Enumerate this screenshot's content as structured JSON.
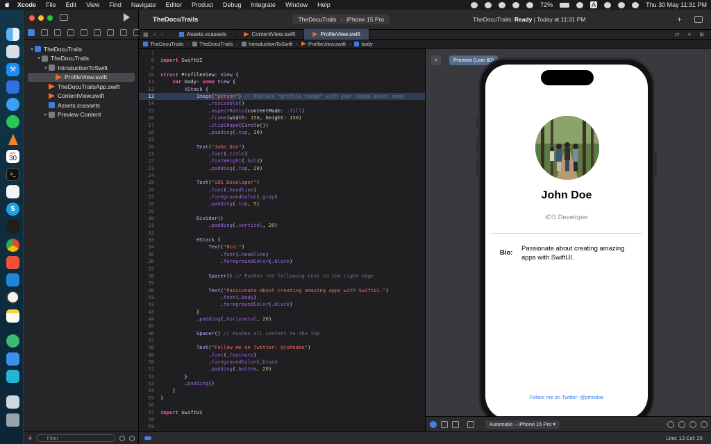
{
  "menubar": {
    "items": [
      "Xcode",
      "File",
      "Edit",
      "View",
      "Find",
      "Navigate",
      "Editor",
      "Product",
      "Debug",
      "Integrate",
      "Window",
      "Help"
    ],
    "battery": "72%",
    "datetime": "Thu 30 May  11:31 PM",
    "input_source": "A"
  },
  "dock": {
    "calendar_day": "30",
    "calendar_month": "MAY",
    "apps": [
      "finder-icon",
      "launchpad-icon",
      "xcode-icon",
      "simulator-icon",
      "safari-icon",
      "whatsapp-icon",
      "vlc-icon",
      "calendar-icon",
      "terminal-icon",
      "reminders-icon",
      "skype-icon",
      "figma-icon",
      "chrome-icon",
      "swift-playgrounds-icon",
      "vscode-icon",
      "clock-icon",
      "notes-icon",
      "time-machine-icon",
      "mail-icon",
      "canva-icon",
      "screenshot-icon",
      "trash-icon"
    ]
  },
  "navigator": {
    "filter_placeholder": "Filter",
    "tree": [
      {
        "label": "TheDocuTrails",
        "indent": 0,
        "kind": "proj",
        "chev": "▾"
      },
      {
        "label": "TheDocuTrails",
        "indent": 1,
        "kind": "folder",
        "chev": "▾"
      },
      {
        "label": "IntroductionToSwift",
        "indent": 2,
        "kind": "folder",
        "chev": "▾"
      },
      {
        "label": "ProfileView.swift",
        "indent": 3,
        "kind": "swift",
        "chev": "",
        "selected": true
      },
      {
        "label": "TheDocuTrailsApp.swift",
        "indent": 2,
        "kind": "swift",
        "chev": ""
      },
      {
        "label": "ContentView.swift",
        "indent": 2,
        "kind": "swift",
        "chev": ""
      },
      {
        "label": "Assets.xcassets",
        "indent": 2,
        "kind": "assets",
        "chev": ""
      },
      {
        "label": "Preview Content",
        "indent": 2,
        "kind": "folder",
        "chev": "▸"
      }
    ]
  },
  "toolbar": {
    "title": "TheDocuTrails",
    "scheme_target": "TheDocuTrails",
    "scheme_device": "iPhone 15 Pro",
    "status_project": "TheDocuTrails:",
    "status_state": "Ready",
    "status_time": "| Today at 11:31 PM"
  },
  "tabs": [
    {
      "label": "Assets.xcassets",
      "active": false
    },
    {
      "label": "ContentView.swift",
      "active": false
    },
    {
      "label": "ProfileView.swift",
      "active": true
    }
  ],
  "jumpbar": [
    "TheDocuTrails",
    "TheDocuTrails",
    "IntroductionToSwift",
    "ProfileView.swift",
    "body"
  ],
  "code": [
    {
      "n": "7",
      "h": []
    },
    {
      "n": "8",
      "h": [
        [
          "kw",
          "import"
        ],
        [
          "pl",
          " SwiftUI"
        ]
      ]
    },
    {
      "n": "9",
      "h": []
    },
    {
      "n": "10",
      "h": [
        [
          "kw",
          "struct"
        ],
        [
          "pl",
          " ProfileView: "
        ],
        [
          "ty",
          "View"
        ],
        [
          "pl",
          " {"
        ]
      ]
    },
    {
      "n": "11",
      "h": [
        [
          "pl",
          "    "
        ],
        [
          "kw",
          "var"
        ],
        [
          "pl",
          " body: "
        ],
        [
          "kw",
          "some"
        ],
        [
          "pl",
          " "
        ],
        [
          "ty",
          "View"
        ],
        [
          "pl",
          " {"
        ]
      ]
    },
    {
      "n": "12",
      "h": [
        [
          "pl",
          "        "
        ],
        [
          "ty",
          "VStack"
        ],
        [
          "pl",
          " {"
        ]
      ]
    },
    {
      "n": "13",
      "cur": true,
      "h": [
        [
          "pl",
          "            "
        ],
        [
          "ty",
          "Image"
        ],
        [
          "pl",
          "("
        ],
        [
          "str",
          "\"person\""
        ],
        [
          "pl",
          ") "
        ],
        [
          "cmt",
          "// Replace \"profile_image\" with your image asset name"
        ]
      ]
    },
    {
      "n": "14",
      "h": [
        [
          "pl",
          "                ."
        ],
        [
          "mem",
          "resizable"
        ],
        [
          "pl",
          "()"
        ]
      ]
    },
    {
      "n": "15",
      "h": [
        [
          "pl",
          "                ."
        ],
        [
          "mem",
          "aspectRatio"
        ],
        [
          "pl",
          "(contentMode: ."
        ],
        [
          "mem",
          "fill"
        ],
        [
          "pl",
          ")"
        ]
      ]
    },
    {
      "n": "16",
      "h": [
        [
          "pl",
          "                ."
        ],
        [
          "mem",
          "frame"
        ],
        [
          "pl",
          "(width: "
        ],
        [
          "num",
          "150"
        ],
        [
          "pl",
          ", height: "
        ],
        [
          "num",
          "150"
        ],
        [
          "pl",
          ")"
        ]
      ]
    },
    {
      "n": "17",
      "h": [
        [
          "pl",
          "                ."
        ],
        [
          "mem",
          "clipShape"
        ],
        [
          "pl",
          "("
        ],
        [
          "ty",
          "Circle"
        ],
        [
          "pl",
          "())"
        ]
      ]
    },
    {
      "n": "18",
      "h": [
        [
          "pl",
          "                ."
        ],
        [
          "mem",
          "padding"
        ],
        [
          "pl",
          "(."
        ],
        [
          "mem",
          "top"
        ],
        [
          "pl",
          ", "
        ],
        [
          "num",
          "30"
        ],
        [
          "pl",
          ")"
        ]
      ]
    },
    {
      "n": "19",
      "h": []
    },
    {
      "n": "20",
      "h": [
        [
          "pl",
          "            "
        ],
        [
          "ty",
          "Text"
        ],
        [
          "pl",
          "("
        ],
        [
          "str",
          "\"John Doe\""
        ],
        [
          "pl",
          ")"
        ]
      ]
    },
    {
      "n": "21",
      "h": [
        [
          "pl",
          "                ."
        ],
        [
          "mem",
          "font"
        ],
        [
          "pl",
          "(."
        ],
        [
          "mem",
          "title"
        ],
        [
          "pl",
          ")"
        ]
      ]
    },
    {
      "n": "22",
      "h": [
        [
          "pl",
          "                ."
        ],
        [
          "mem",
          "fontWeight"
        ],
        [
          "pl",
          "(."
        ],
        [
          "mem",
          "bold"
        ],
        [
          "pl",
          ")"
        ]
      ]
    },
    {
      "n": "23",
      "h": [
        [
          "pl",
          "                ."
        ],
        [
          "mem",
          "padding"
        ],
        [
          "pl",
          "(."
        ],
        [
          "mem",
          "top"
        ],
        [
          "pl",
          ", "
        ],
        [
          "num",
          "20"
        ],
        [
          "pl",
          ")"
        ]
      ]
    },
    {
      "n": "24",
      "h": []
    },
    {
      "n": "25",
      "h": [
        [
          "pl",
          "            "
        ],
        [
          "ty",
          "Text"
        ],
        [
          "pl",
          "("
        ],
        [
          "str",
          "\"iOS Developer\""
        ],
        [
          "pl",
          ")"
        ]
      ]
    },
    {
      "n": "26",
      "h": [
        [
          "pl",
          "                ."
        ],
        [
          "mem",
          "font"
        ],
        [
          "pl",
          "(."
        ],
        [
          "mem",
          "headline"
        ],
        [
          "pl",
          ")"
        ]
      ]
    },
    {
      "n": "27",
      "h": [
        [
          "pl",
          "                ."
        ],
        [
          "mem",
          "foregroundColor"
        ],
        [
          "pl",
          "(."
        ],
        [
          "mem",
          "gray"
        ],
        [
          "pl",
          ")"
        ]
      ]
    },
    {
      "n": "28",
      "h": [
        [
          "pl",
          "                ."
        ],
        [
          "mem",
          "padding"
        ],
        [
          "pl",
          "(."
        ],
        [
          "mem",
          "top"
        ],
        [
          "pl",
          ", "
        ],
        [
          "num",
          "5"
        ],
        [
          "pl",
          ")"
        ]
      ]
    },
    {
      "n": "29",
      "h": []
    },
    {
      "n": "30",
      "h": [
        [
          "pl",
          "            "
        ],
        [
          "ty",
          "Divider"
        ],
        [
          "pl",
          "()"
        ]
      ]
    },
    {
      "n": "31",
      "h": [
        [
          "pl",
          "                ."
        ],
        [
          "mem",
          "padding"
        ],
        [
          "pl",
          "(."
        ],
        [
          "mem",
          "vertical"
        ],
        [
          "pl",
          ", "
        ],
        [
          "num",
          "20"
        ],
        [
          "pl",
          ")"
        ]
      ]
    },
    {
      "n": "32",
      "h": []
    },
    {
      "n": "33",
      "h": [
        [
          "pl",
          "            "
        ],
        [
          "ty",
          "HStack"
        ],
        [
          "pl",
          " {"
        ]
      ]
    },
    {
      "n": "34",
      "h": [
        [
          "pl",
          "                "
        ],
        [
          "ty",
          "Text"
        ],
        [
          "pl",
          "("
        ],
        [
          "str",
          "\"Bio:\""
        ],
        [
          "pl",
          ")"
        ]
      ]
    },
    {
      "n": "35",
      "h": [
        [
          "pl",
          "                    ."
        ],
        [
          "mem",
          "font"
        ],
        [
          "pl",
          "(."
        ],
        [
          "mem",
          "headline"
        ],
        [
          "pl",
          ")"
        ]
      ]
    },
    {
      "n": "36",
      "h": [
        [
          "pl",
          "                    ."
        ],
        [
          "mem",
          "foregroundColor"
        ],
        [
          "pl",
          "(."
        ],
        [
          "mem",
          "black"
        ],
        [
          "pl",
          ")"
        ]
      ]
    },
    {
      "n": "37",
      "h": []
    },
    {
      "n": "38",
      "h": [
        [
          "pl",
          "                "
        ],
        [
          "ty",
          "Spacer"
        ],
        [
          "pl",
          "() "
        ],
        [
          "cmt",
          "// Pushes the following text to the right edge"
        ]
      ]
    },
    {
      "n": "39",
      "h": []
    },
    {
      "n": "40",
      "h": [
        [
          "pl",
          "                "
        ],
        [
          "ty",
          "Text"
        ],
        [
          "pl",
          "("
        ],
        [
          "str",
          "\"Passionate about creating amazing apps with SwiftUI.\""
        ],
        [
          "pl",
          ")"
        ]
      ]
    },
    {
      "n": "41",
      "h": [
        [
          "pl",
          "                    ."
        ],
        [
          "mem",
          "font"
        ],
        [
          "pl",
          "(."
        ],
        [
          "mem",
          "body"
        ],
        [
          "pl",
          ")"
        ]
      ]
    },
    {
      "n": "42",
      "h": [
        [
          "pl",
          "                    ."
        ],
        [
          "mem",
          "foregroundColor"
        ],
        [
          "pl",
          "(."
        ],
        [
          "mem",
          "black"
        ],
        [
          "pl",
          ")"
        ]
      ]
    },
    {
      "n": "43",
      "h": [
        [
          "pl",
          "            }"
        ]
      ]
    },
    {
      "n": "44",
      "h": [
        [
          "pl",
          "            ."
        ],
        [
          "mem",
          "padding"
        ],
        [
          "pl",
          "(."
        ],
        [
          "mem",
          "horizontal"
        ],
        [
          "pl",
          ", "
        ],
        [
          "num",
          "20"
        ],
        [
          "pl",
          ")"
        ]
      ]
    },
    {
      "n": "45",
      "h": []
    },
    {
      "n": "46",
      "h": [
        [
          "pl",
          "            "
        ],
        [
          "ty",
          "Spacer"
        ],
        [
          "pl",
          "() "
        ],
        [
          "cmt",
          "// Pushes all content to the top"
        ]
      ]
    },
    {
      "n": "47",
      "h": []
    },
    {
      "n": "48",
      "h": [
        [
          "pl",
          "            "
        ],
        [
          "ty",
          "Text"
        ],
        [
          "pl",
          "("
        ],
        [
          "str",
          "\"Follow me on Twitter: @johndoe\""
        ],
        [
          "pl",
          ")"
        ]
      ]
    },
    {
      "n": "49",
      "h": [
        [
          "pl",
          "                ."
        ],
        [
          "mem",
          "font"
        ],
        [
          "pl",
          "(."
        ],
        [
          "mem",
          "footnote"
        ],
        [
          "pl",
          ")"
        ]
      ]
    },
    {
      "n": "50",
      "h": [
        [
          "pl",
          "                ."
        ],
        [
          "mem",
          "foregroundColor"
        ],
        [
          "pl",
          "(."
        ],
        [
          "mem",
          "blue"
        ],
        [
          "pl",
          ")"
        ]
      ]
    },
    {
      "n": "51",
      "h": [
        [
          "pl",
          "                ."
        ],
        [
          "mem",
          "padding"
        ],
        [
          "pl",
          "(."
        ],
        [
          "mem",
          "bottom"
        ],
        [
          "pl",
          ", "
        ],
        [
          "num",
          "20"
        ],
        [
          "pl",
          ")"
        ]
      ]
    },
    {
      "n": "52",
      "h": [
        [
          "pl",
          "        }"
        ]
      ]
    },
    {
      "n": "53",
      "h": [
        [
          "pl",
          "        ."
        ],
        [
          "mem",
          "padding"
        ],
        [
          "pl",
          "()"
        ]
      ]
    },
    {
      "n": "54",
      "h": [
        [
          "pl",
          "    }"
        ]
      ]
    },
    {
      "n": "55",
      "h": [
        [
          "pl",
          "}"
        ]
      ]
    },
    {
      "n": "56",
      "h": []
    },
    {
      "n": "57",
      "h": [
        [
          "kw",
          "import"
        ],
        [
          "pl",
          " SwiftUI"
        ]
      ]
    },
    {
      "n": "58",
      "h": []
    },
    {
      "n": "59",
      "h": []
    }
  ],
  "canvas": {
    "preview_label": "Preview (Line 60)",
    "device_label": "Automatic – iPhone 15 Pro",
    "profile": {
      "name": "John Doe",
      "role": "iOS Developer",
      "bio_label": "Bio:",
      "bio_text": "Passionate about creating amazing apps with SwiftUI.",
      "follow": "Follow me on Twitter: @johndoe"
    }
  },
  "statusbar": {
    "position": "Line: 13  Col: 26"
  },
  "colors": {
    "accent": "#3f83e8",
    "swift_orange": "#ee6b32",
    "link_blue": "#2f7bf5"
  }
}
